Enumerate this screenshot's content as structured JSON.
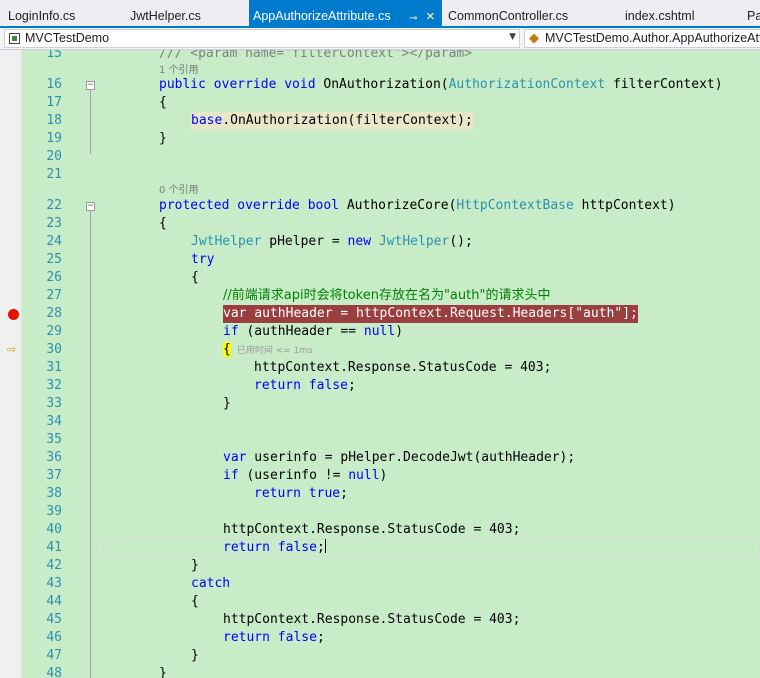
{
  "tabs": [
    {
      "label": "LoginInfo.cs",
      "active": false
    },
    {
      "label": "JwtHelper.cs",
      "active": false
    },
    {
      "label": "AppAuthorizeAttribute.cs",
      "active": true
    },
    {
      "label": "CommonController.cs",
      "active": false
    },
    {
      "label": "index.cshtml",
      "active": false
    },
    {
      "label": "Pa",
      "active": false
    }
  ],
  "icons": {
    "pin": "pin-icon",
    "close": "close-icon",
    "breakpoint": "breakpoint-icon",
    "exec": "execution-arrow-icon"
  },
  "navbar": {
    "project": "MVCTestDemo",
    "member": "MVCTestDemo.Author.AppAuthorizeAttribute"
  },
  "codelens": {
    "ref1": "1 个引用",
    "ref0": "0 个引用"
  },
  "perf_tip": "已用时间 <= 1ms",
  "colors": {
    "keyword": "#0000ff",
    "type": "#2b91af",
    "comment": "#008000",
    "string": "#a31515",
    "breakpoint": "#e51400",
    "editor_bg": "#c8ecc8"
  },
  "lines": {
    "l15": {
      "num": "15",
      "text": "/// <param name=\"filterContext\"></param>"
    },
    "l16": {
      "num": "16",
      "kw": "public override void",
      "name": " OnAuthorization(",
      "type": "AuthorizationContext",
      "rest": " filterContext)"
    },
    "l17": {
      "num": "17",
      "text": "{"
    },
    "l18": {
      "num": "18",
      "kw": "base",
      "rest": ".OnAuthorization(filterContext);"
    },
    "l19": {
      "num": "19",
      "text": "}"
    },
    "l20": {
      "num": "20",
      "text": ""
    },
    "l21": {
      "num": "21",
      "text": ""
    },
    "l22": {
      "num": "22",
      "kw": "protected override bool",
      "name": " AuthorizeCore(",
      "type": "HttpContextBase",
      "rest": " httpContext)"
    },
    "l23": {
      "num": "23",
      "text": "{"
    },
    "l24": {
      "num": "24",
      "type": "JwtHelper",
      "mid": " pHelper = ",
      "kw": "new",
      "type2": " JwtHelper",
      "rest": "();"
    },
    "l25": {
      "num": "25",
      "kw": "try"
    },
    "l26": {
      "num": "26",
      "text": "{"
    },
    "l27": {
      "num": "27",
      "text": "//前端请求api时会将token存放在名为\"auth\"的请求头中"
    },
    "l28": {
      "num": "28",
      "kw": "var",
      "mid": " authHeader = httpContext.Request.Headers[",
      "str": "\"auth\"",
      "rest": "];"
    },
    "l29": {
      "num": "29",
      "kw": "if",
      "mid": " (authHeader == ",
      "kw2": "null",
      "rest": ")"
    },
    "l30": {
      "num": "30",
      "text": "{"
    },
    "l31": {
      "num": "31",
      "text": "httpContext.Response.StatusCode = 403;"
    },
    "l32": {
      "num": "32",
      "kw": "return",
      "kw2": " false",
      "rest": ";"
    },
    "l33": {
      "num": "33",
      "text": "}"
    },
    "l34": {
      "num": "34",
      "text": ""
    },
    "l35": {
      "num": "35",
      "text": ""
    },
    "l36": {
      "num": "36",
      "kw": "var",
      "rest": " userinfo = pHelper.DecodeJwt(authHeader);"
    },
    "l37": {
      "num": "37",
      "kw": "if",
      "mid": " (userinfo != ",
      "kw2": "null",
      "rest": ")"
    },
    "l38": {
      "num": "38",
      "kw": "return",
      "kw2": " true",
      "rest": ";"
    },
    "l39": {
      "num": "39",
      "text": ""
    },
    "l40": {
      "num": "40",
      "text": "httpContext.Response.StatusCode = 403;"
    },
    "l41": {
      "num": "41",
      "kw": "return",
      "kw2": " false",
      "rest": ";"
    },
    "l42": {
      "num": "42",
      "text": "}"
    },
    "l43": {
      "num": "43",
      "kw": "catch"
    },
    "l44": {
      "num": "44",
      "text": "{"
    },
    "l45": {
      "num": "45",
      "text": "httpContext.Response.StatusCode = 403;"
    },
    "l46": {
      "num": "46",
      "kw": "return",
      "kw2": " false",
      "rest": ";"
    },
    "l47": {
      "num": "47",
      "text": "}"
    },
    "l48": {
      "num": "48",
      "text": "}"
    }
  }
}
